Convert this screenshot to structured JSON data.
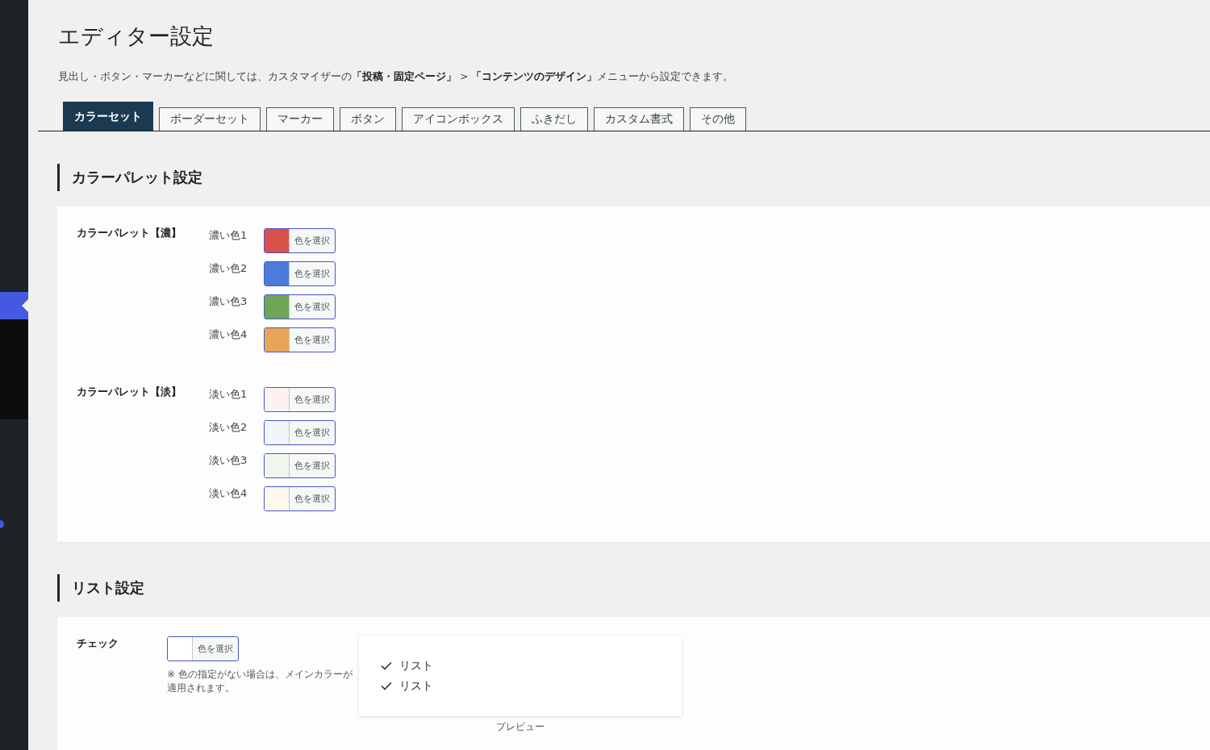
{
  "page": {
    "title": "エディター設定",
    "description": "見出し・ボタン・マーカーなどに関しては、カスタマイザーの**「投稿・固定ページ」** > **「コンテンツのデザイン」**メニューから設定できます。"
  },
  "tabs": [
    {
      "label": "カラーセット",
      "selected": true
    },
    {
      "label": "ボーダーセット",
      "selected": false
    },
    {
      "label": "マーカー",
      "selected": false
    },
    {
      "label": "ボタン",
      "selected": false
    },
    {
      "label": "アイコンボックス",
      "selected": false
    },
    {
      "label": "ふきだし",
      "selected": false
    },
    {
      "label": "カスタム書式",
      "selected": false
    },
    {
      "label": "その他",
      "selected": false
    }
  ],
  "color_palette": {
    "heading": "カラーパレット設定",
    "groups": [
      {
        "label": "カラーパレット【濃】",
        "rows": [
          {
            "label": "濃い色1",
            "color": "#d8514b",
            "button": "色を選択"
          },
          {
            "label": "濃い色2",
            "color": "#4c7bd8",
            "button": "色を選択"
          },
          {
            "label": "濃い色3",
            "color": "#6fa556",
            "button": "色を選択"
          },
          {
            "label": "濃い色4",
            "color": "#e8a55a",
            "button": "色を選択"
          }
        ]
      },
      {
        "label": "カラーパレット【淡】",
        "rows": [
          {
            "label": "淡い色1",
            "color": "#fdf2f2",
            "button": "色を選択"
          },
          {
            "label": "淡い色2",
            "color": "#f2f5fb",
            "button": "色を選択"
          },
          {
            "label": "淡い色3",
            "color": "#f1f7ef",
            "button": "色を選択"
          },
          {
            "label": "淡い色4",
            "color": "#fdf8ee",
            "button": "色を選択"
          }
        ]
      }
    ]
  },
  "list_settings": {
    "heading": "リスト設定",
    "items": [
      {
        "label": "チェック",
        "button": "色を選択",
        "note": "※ 色の指定がない場合は、メインカラーが適用されます。",
        "preview": {
          "items": [
            "リスト",
            "リスト"
          ],
          "caption": "プレビュー"
        }
      }
    ]
  }
}
